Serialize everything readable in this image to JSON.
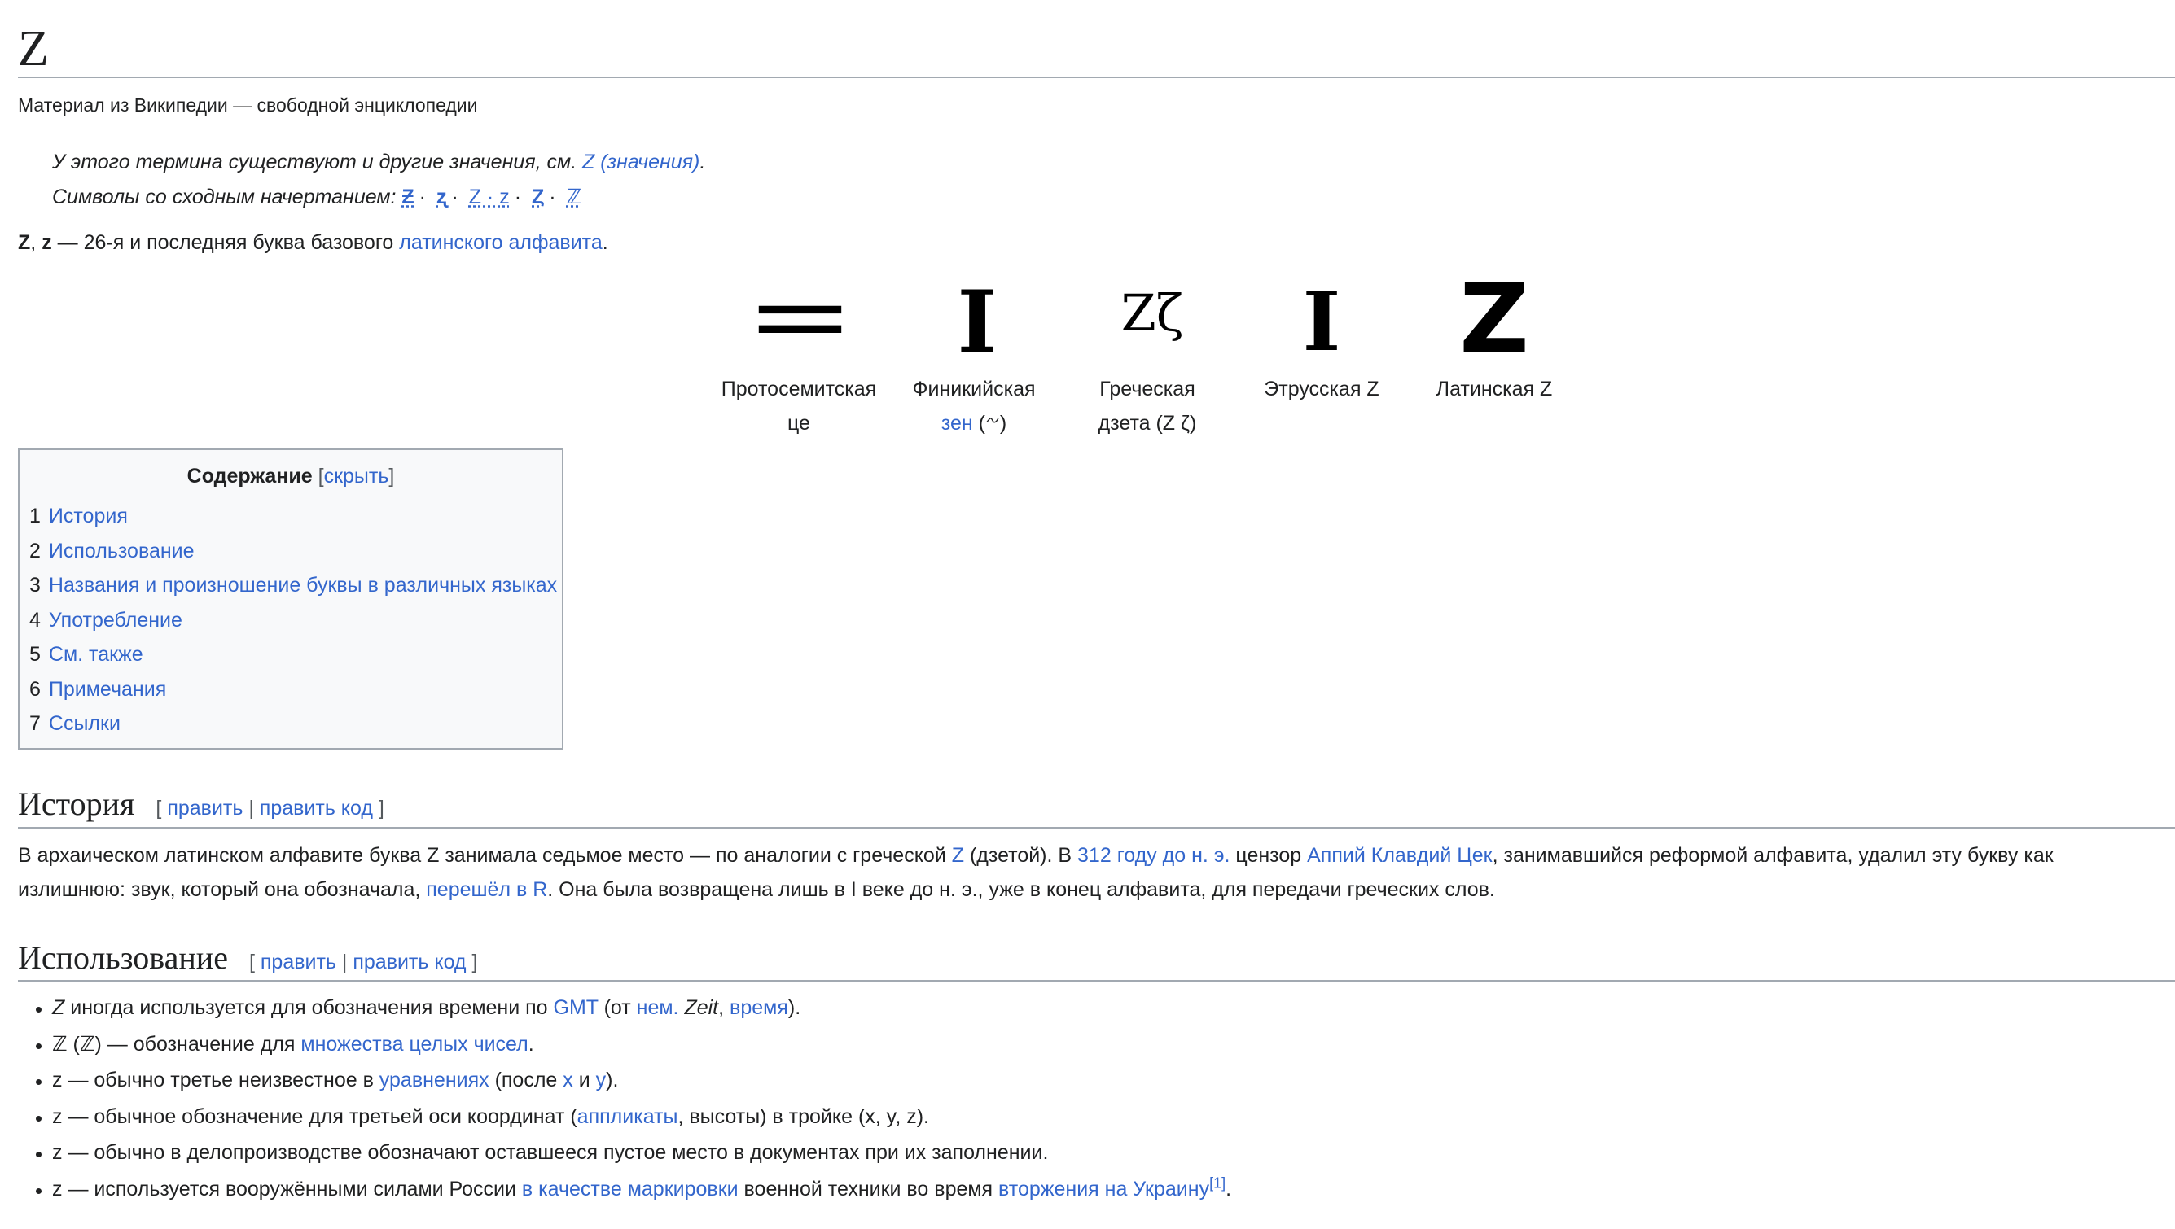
{
  "article": {
    "title": "Z",
    "tagline": "Материал из Википедии — свободной энциклопедии"
  },
  "hatnote": {
    "line1_text": "У этого термина существуют и другие значения, см. ",
    "line1_link": "Z (значения)",
    "line1_end": ".",
    "line2_text": "Символы со сходным начертанием: ",
    "symbols": [
      "Ƶ",
      "ʐ",
      "Z · z",
      "Ȥ",
      "ℤ"
    ],
    "sep": "·"
  },
  "intro": {
    "bold1": "Z",
    "comma": ", ",
    "bold2": "z",
    "text": " — 26-я и последняя буква базового ",
    "link": "латинского алфавита",
    "end": "."
  },
  "evolution": {
    "glyphs": [
      "=",
      "I",
      "Zζ",
      "I",
      "Z"
    ],
    "items": [
      {
        "line1": "Протосемитская",
        "line2": "це"
      },
      {
        "line1": "Финикийская",
        "link": "зен",
        "extra": " (𐤆)"
      },
      {
        "line1": "Греческая",
        "line2": "дзета (Ζ ζ)"
      },
      {
        "line1": "Этрусская Z"
      },
      {
        "line1": "Латинская Z"
      }
    ]
  },
  "toc": {
    "title": "Содержание",
    "toggle_open": "[",
    "toggle": "скрыть",
    "toggle_close": "]",
    "items": [
      {
        "num": "1",
        "label": "История"
      },
      {
        "num": "2",
        "label": "Использование"
      },
      {
        "num": "3",
        "label": "Названия и произношение буквы в различных языках"
      },
      {
        "num": "4",
        "label": "Употребление"
      },
      {
        "num": "5",
        "label": "См. также"
      },
      {
        "num": "6",
        "label": "Примечания"
      },
      {
        "num": "7",
        "label": "Ссылки"
      }
    ]
  },
  "edit": {
    "open": "[",
    "edit": "править",
    "pipe": " | ",
    "edit_code": "править код",
    "close": "]"
  },
  "history": {
    "heading": "История",
    "t1": "В архаическом латинском алфавите буква Z занимала седьмое место — по аналогии с греческой ",
    "l1": "Ζ",
    "t2": " (дзетой). В ",
    "l2": "312 году до н. э.",
    "t3": " цензор ",
    "l3": "Аппий Клавдий Цек",
    "t4": ", занимавшийся реформой алфавита, удалил эту букву как",
    "t5": "излишнюю: звук, который она обозначала, ",
    "l4": "перешёл в R",
    "t6": ". Она была возвращена лишь в I веке до н. э., уже в конец алфавита, для передачи греческих слов."
  },
  "usage": {
    "heading": "Использование",
    "b1": {
      "a": "Z",
      "b": " иногда используется для обозначения времени по ",
      "l1": "GMT",
      "c": " (от ",
      "l2": "нем.",
      "d": " ",
      "e": "Zeit",
      "f": ", ",
      "l3": "время",
      "g": ")."
    },
    "b2": {
      "a": "ℤ (ℤ) — обозначение для ",
      "l1": "множества целых чисел",
      "b": "."
    },
    "b3": {
      "a": "z — обычно третье неизвестное в ",
      "l1": "уравнениях",
      "b": " (после ",
      "l2": "x",
      "c": " и ",
      "l3": "y",
      "d": ")."
    },
    "b4": {
      "a": "z — обычное обозначение для третьей оси координат (",
      "l1": "аппликаты",
      "b": ", высоты) в тройке (x, y, z)."
    },
    "b5": {
      "a": "z — обычно в делопроизводстве обозначают оставшееся пустое место в документах при их заполнении."
    },
    "b6": {
      "a": "z — используется вооружёнными силами России ",
      "l1": "в качестве маркировки",
      "b": " военной техники во время ",
      "l2": "вторжения на Украину",
      "ref": "[1]",
      "c": "."
    }
  }
}
